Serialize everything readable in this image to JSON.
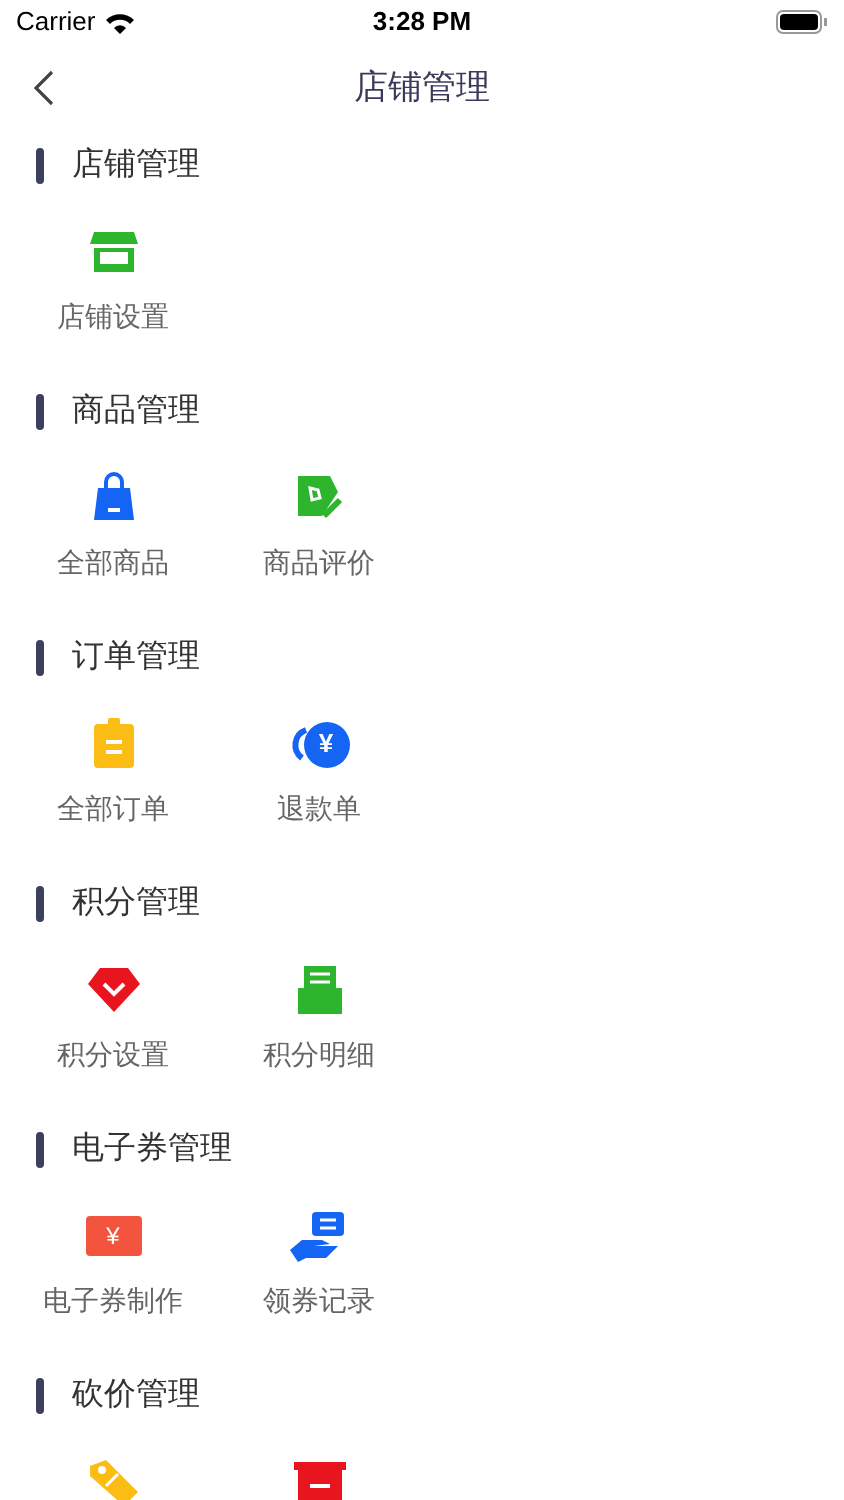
{
  "status_bar": {
    "carrier": "Carrier",
    "time": "3:28 PM"
  },
  "nav": {
    "title": "店铺管理"
  },
  "sections": [
    {
      "title": "店铺管理",
      "items": [
        {
          "kind": "store",
          "label": "店铺设置"
        }
      ]
    },
    {
      "title": "商品管理",
      "items": [
        {
          "kind": "bag",
          "label": "全部商品"
        },
        {
          "kind": "tag-edit",
          "label": "商品评价"
        }
      ]
    },
    {
      "title": "订单管理",
      "items": [
        {
          "kind": "clipboard",
          "label": "全部订单"
        },
        {
          "kind": "refund",
          "glyph": "¥",
          "label": "退款单"
        }
      ]
    },
    {
      "title": "积分管理",
      "items": [
        {
          "kind": "gem",
          "label": "积分设置"
        },
        {
          "kind": "tray",
          "label": "积分明细"
        }
      ]
    },
    {
      "title": "电子券管理",
      "items": [
        {
          "kind": "ticket",
          "glyph": "¥",
          "label": "电子券制作"
        },
        {
          "kind": "hand-ticket",
          "label": "领券记录"
        }
      ]
    },
    {
      "title": "砍价管理",
      "items": [
        {
          "kind": "price-tag"
        },
        {
          "kind": "box"
        }
      ]
    }
  ]
}
